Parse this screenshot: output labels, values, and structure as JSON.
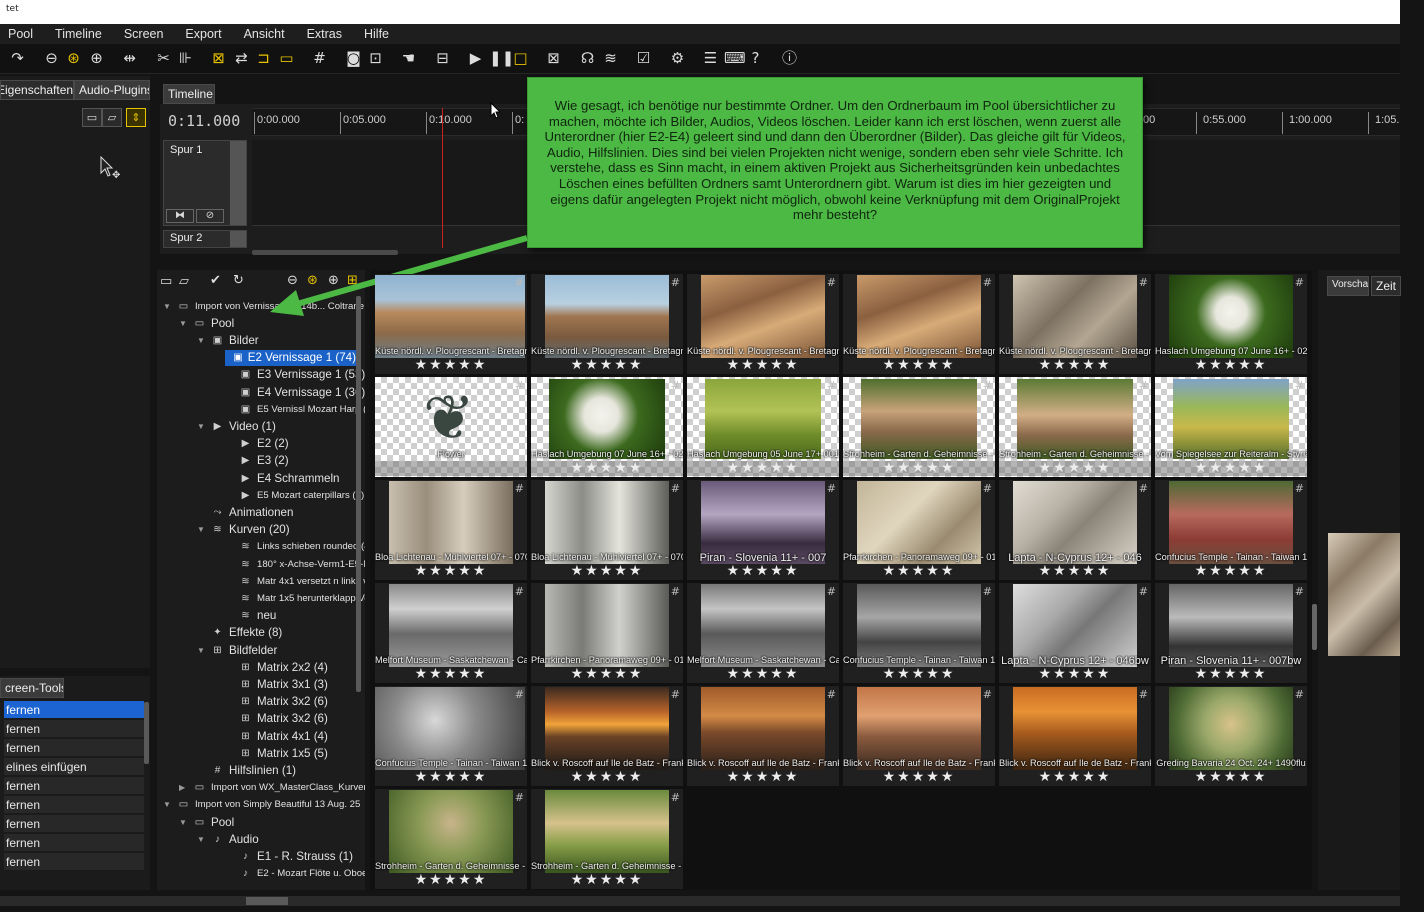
{
  "window": {
    "title": "tet"
  },
  "menu": [
    "Pool",
    "Timeline",
    "Screen",
    "Export",
    "Ansicht",
    "Extras",
    "Hilfe"
  ],
  "left_tabs": {
    "eigenschaften": "Eigenschaften",
    "audio_plugins": "Audio-Plugins"
  },
  "timeline": {
    "tab": "Timeline",
    "timecode": "0:11.000",
    "ticks": [
      "0:00.000",
      "0:05.000",
      "0:10.000",
      "0:",
      "00",
      "0:55.000",
      "1:00.000",
      "1:05."
    ],
    "tracks": [
      "Spur 1",
      "Spur 2"
    ]
  },
  "tooltip": {
    "text": "Wie gesagt, ich benötige nur bestimmte Ordner. Um den Ordnerbaum im Pool  übersichtlicher zu machen, möchte ich Bilder, Audios, Videos löschen. Leider kann ich erst löschen, wenn zuerst alle Unterordner (hier E2-E4) geleert sind und dann den Überordner (Bilder). Das gleiche gilt für Videos, Audio, Hilfslinien. Dies sind bei vielen Projekten nicht wenige, sondern eben sehr viele Schritte. Ich verstehe, dass es Sinn macht, in einem aktiven  Projekt aus Sicherheitsgründen kein unbedachtes Löschen eines befüllten Ordners samt Unterordnern gibt. Warum ist  dies im hier gezeigten und eigens dafür angelegten Projekt nicht möglich, obwohl keine Verknüpfung mit dem OriginalProjekt mehr besteht?"
  },
  "tree": [
    {
      "label": "Import von Vernissage... 14b... Coltrane Au...",
      "lvl": 0,
      "arrow": "▼",
      "icon": "folder",
      "small": true
    },
    {
      "label": "Pool",
      "lvl": 1,
      "arrow": "▼",
      "icon": "folder"
    },
    {
      "label": "Bilder",
      "lvl": 2,
      "arrow": "▼",
      "icon": "image"
    },
    {
      "label": "E2 Vernissage 1 (74)",
      "lvl": 3,
      "icon": "image",
      "selected": true
    },
    {
      "label": "E3 Vernissage 1 (53)",
      "lvl": 3,
      "icon": "image"
    },
    {
      "label": "E4 Vernissage 1 (36)",
      "lvl": 3,
      "icon": "image"
    },
    {
      "label": "E5 Vernissl Mozart Harp (58)",
      "lvl": 3,
      "icon": "image",
      "small": true
    },
    {
      "label": "Video (1)",
      "lvl": 2,
      "arrow": "▼",
      "icon": "video"
    },
    {
      "label": "E2 (2)",
      "lvl": 3,
      "icon": "video"
    },
    {
      "label": "E3 (2)",
      "lvl": 3,
      "icon": "video"
    },
    {
      "label": "E4 Schrammeln",
      "lvl": 3,
      "icon": "video"
    },
    {
      "label": "E5 Mozart caterpillars (3)",
      "lvl": 3,
      "icon": "video",
      "small": true
    },
    {
      "label": "Animationen",
      "lvl": 2,
      "icon": "anim"
    },
    {
      "label": "Kurven (20)",
      "lvl": 2,
      "arrow": "▼",
      "icon": "curve"
    },
    {
      "label": "Links schieben rounded (4)",
      "lvl": 3,
      "icon": "curve",
      "small": true
    },
    {
      "label": "180° x-Achse-Verm1-E5-Min...",
      "lvl": 3,
      "icon": "curve",
      "small": true
    },
    {
      "label": "Matr 4x1 versetzt n links v...",
      "lvl": 3,
      "icon": "curve",
      "small": true
    },
    {
      "label": "Matr 1x5 herunterklapp Ve...",
      "lvl": 3,
      "icon": "curve",
      "small": true
    },
    {
      "label": "neu",
      "lvl": 3,
      "icon": "curve"
    },
    {
      "label": "Effekte (8)",
      "lvl": 2,
      "icon": "effect"
    },
    {
      "label": "Bildfelder",
      "lvl": 2,
      "arrow": "▼",
      "icon": "grid"
    },
    {
      "label": "Matrix 2x2 (4)",
      "lvl": 3,
      "icon": "grid"
    },
    {
      "label": "Matrix 3x1 (3)",
      "lvl": 3,
      "icon": "grid"
    },
    {
      "label": "Matrix 3x2 (6)",
      "lvl": 3,
      "icon": "grid"
    },
    {
      "label": "Matrix 3x2 (6)",
      "lvl": 3,
      "icon": "grid"
    },
    {
      "label": "Matrix 4x1 (4)",
      "lvl": 3,
      "icon": "grid"
    },
    {
      "label": "Matrix 1x5 (5)",
      "lvl": 3,
      "icon": "grid"
    },
    {
      "label": "Hilfslinien (1)",
      "lvl": 2,
      "icon": "hash"
    },
    {
      "label": "Import von WX_MasterClass_Kurven_...",
      "lvl": 1,
      "arrow": "▶",
      "icon": "folder",
      "small": true
    },
    {
      "label": "Import von Simply Beautiful  13 Aug. 25",
      "lvl": 0,
      "arrow": "▼",
      "icon": "folder",
      "small": true
    },
    {
      "label": "Pool",
      "lvl": 1,
      "arrow": "▼",
      "icon": "folder"
    },
    {
      "label": "Audio",
      "lvl": 2,
      "arrow": "▼",
      "icon": "audio"
    },
    {
      "label": "E1 - R. Strauss (1)",
      "lvl": 3,
      "icon": "audio"
    },
    {
      "label": "E2 - Mozart Flöte u. Oboe (...",
      "lvl": 3,
      "icon": "audio",
      "small": true
    }
  ],
  "thumbs": [
    {
      "caption": "Küste nördl. v. Plougrescant - Bretagne 1...",
      "stars": "★★★★★",
      "kind": "rock1"
    },
    {
      "caption": "Küste nördl. v. Plougrescant - Bretagne 1...",
      "stars": "★★★★★",
      "kind": "rock2"
    },
    {
      "caption": "Küste nördl. v. Plougrescant - Bretagne 1...",
      "stars": "★★★★★",
      "kind": "rock3"
    },
    {
      "caption": "Küste nördl. v. Plougrescant - Bretagne 1...",
      "stars": "★★★★★",
      "kind": "rock3"
    },
    {
      "caption": "Küste nördl. v. Plougrescant - Bretagne 1...",
      "stars": "★★★★★",
      "kind": "rock4"
    },
    {
      "caption": "Haslach Umgebung 07 June 16+ - 021",
      "stars": "★★★★★",
      "kind": "flower"
    },
    {
      "caption": "Flower",
      "stars": "",
      "kind": "plant"
    },
    {
      "caption": "Haslach Umgebung 07 June 16+ - 021",
      "stars": "★★★★★",
      "kind": "flowerc"
    },
    {
      "caption": "Haslach Umgebung  05 June 17+ 001",
      "stars": "★★★★★",
      "kind": "grass"
    },
    {
      "caption": "Strohheim - Garten d. Geheimnisse - Upp...",
      "stars": "★★★★★",
      "kind": "reeds"
    },
    {
      "caption": "Strohheim - Garten d. Geheimnisse - Upp...",
      "stars": "★★★★★",
      "kind": "reedsc"
    },
    {
      "caption": "Vom Spiegelsee zur Reiteralm - Styria 28...",
      "stars": "★★★★★",
      "kind": "treec"
    },
    {
      "caption": "Bloa Lichtenau - Mühlviertel 07+ - 070",
      "stars": "★★★★★",
      "kind": "wall"
    },
    {
      "caption": "Bloa Lichtenau - Mühlviertel 07+ - 070b",
      "stars": "★★★★★",
      "kind": "wallbw"
    },
    {
      "caption": "Piran - Slovenia 11+ - 007",
      "stars": "★★★★★",
      "kind": "window"
    },
    {
      "caption": "Pfarrkirchen - Panoramaweg 09+ - 015",
      "stars": "★★★★★",
      "kind": "wall2"
    },
    {
      "caption": "Lapta - N-Cyprus 12+ - 046",
      "stars": "★★★★★",
      "kind": "stairs"
    },
    {
      "caption": "Confucius Temple - Tainan - Taiwan 12+ - ...",
      "stars": "★★★★★",
      "kind": "temple"
    },
    {
      "caption": "Melfort Museum - Saskatchewan - Canada...",
      "stars": "★★★★★",
      "kind": "lantern"
    },
    {
      "caption": "Pfarrkirchen - Panoramaweg 09+ - 015bw",
      "stars": "★★★★★",
      "kind": "wallbw2"
    },
    {
      "caption": "Melfort Museum - Saskatchewan - Canada...",
      "stars": "★★★★★",
      "kind": "lanternbw"
    },
    {
      "caption": "Confucius Temple - Tainan - Taiwan 12+ - ...",
      "stars": "★★★★★",
      "kind": "templebw"
    },
    {
      "caption": "Lapta - N-Cyprus 12+ - 046bw",
      "stars": "★★★★★",
      "kind": "stairsbw"
    },
    {
      "caption": "Piran - Slovenia 11+ - 007bw",
      "stars": "★★★★★",
      "kind": "windowbw"
    },
    {
      "caption": "Confucius Temple - Tainan - Taiwan 12+ - ...",
      "stars": "★★★★★",
      "kind": "blurbw"
    },
    {
      "caption": "Blick v. Roscoff auf Ile de Batz - Frankreic...",
      "stars": "★★★★★",
      "kind": "sunset1"
    },
    {
      "caption": "Blick v. Roscoff auf Ile de Batz - Frankreic...",
      "stars": "★★★★★",
      "kind": "sunset2"
    },
    {
      "caption": "Blick v. Roscoff auf Ile de Batz - Frankreic...",
      "stars": "★★★★★",
      "kind": "sunset3"
    },
    {
      "caption": "Blick v. Roscoff auf Ile de Batz - Frankreic...",
      "stars": "★★★★★",
      "kind": "sunset4"
    },
    {
      "caption": "Greding Bavaria  24 Oct. 24+  1490flu",
      "stars": "★★★★★",
      "kind": "blurhouse"
    },
    {
      "caption": "Strohheim - Garten d. Geheimnisse - Upp...",
      "stars": "★★★★★",
      "kind": "blurgreen"
    },
    {
      "caption": "Strohheim - Garten d. Geheimnisse - Upp...",
      "stars": "★★★★★",
      "kind": "reeds2"
    }
  ],
  "right_tabs": {
    "vorschau": "Vorschau",
    "zeit": "Zeit"
  },
  "screen_tools": {
    "tab": "creen-Tools",
    "items": [
      "fernen",
      "fernen",
      "fernen",
      "elines einfügen",
      "fernen",
      "fernen",
      "fernen",
      "fernen",
      "fernen"
    ]
  }
}
